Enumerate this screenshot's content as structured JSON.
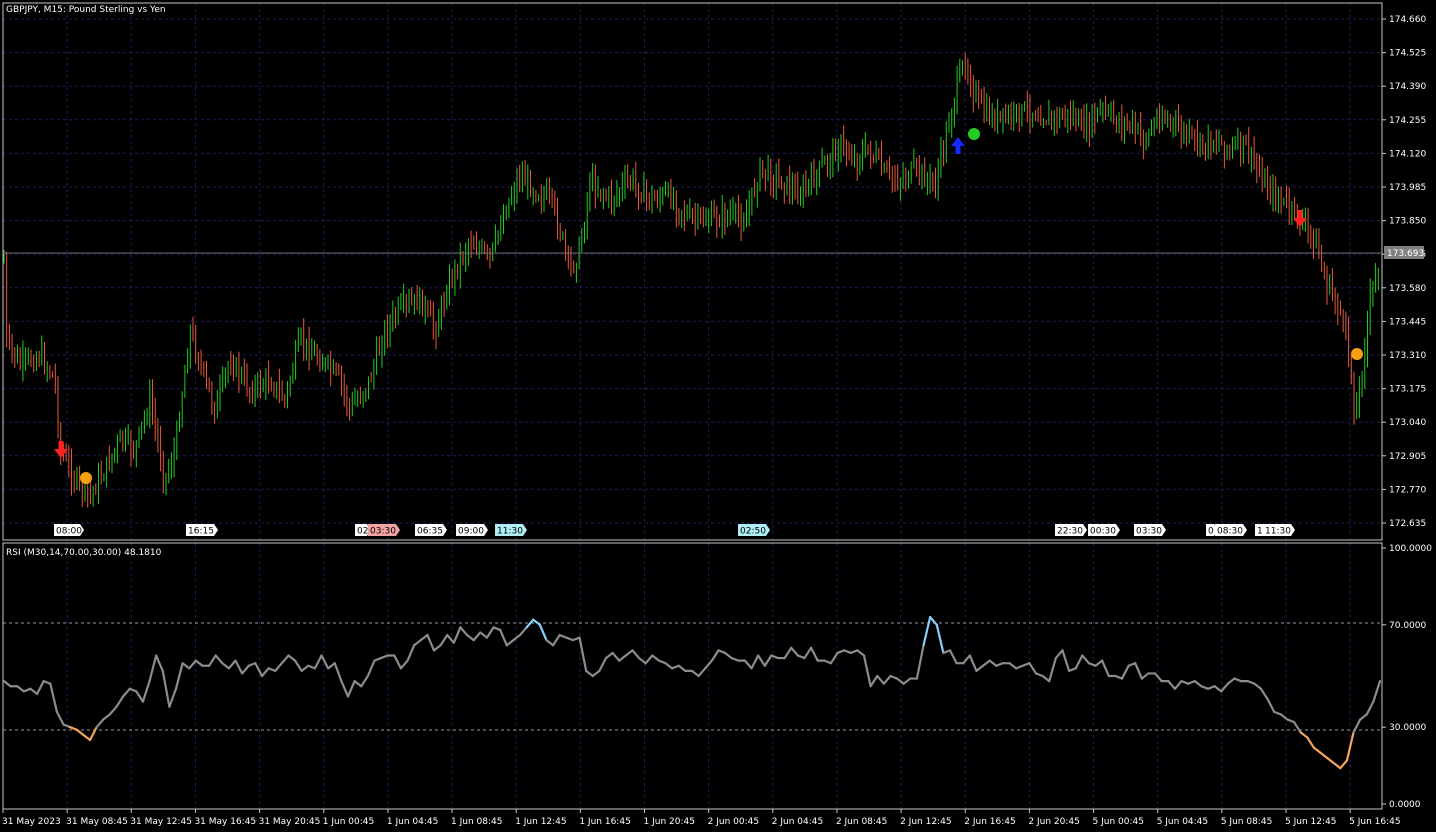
{
  "price_panel": {
    "title": "GBPJPY, M15:  Pound Sterling vs Yen",
    "price_axis_labels": [
      "174.660",
      "174.525",
      "174.390",
      "174.255",
      "174.120",
      "173.985",
      "173.850",
      "173.715",
      "173.580",
      "173.445",
      "173.310",
      "173.175",
      "173.040",
      "172.905",
      "172.770",
      "172.635"
    ],
    "current_price": "173.693",
    "session_tags": [
      {
        "text": "08:00",
        "color": "#ffffff"
      },
      {
        "text": "16:15",
        "color": "#ffffff"
      },
      {
        "text": "02",
        "color": "#ffffff"
      },
      {
        "text": "03:30",
        "color": "#f4a3a3"
      },
      {
        "text": "06:35",
        "color": "#ffffff"
      },
      {
        "text": "09:00",
        "color": "#ffffff"
      },
      {
        "text": "11:30",
        "color": "#aeeef4"
      },
      {
        "text": "02:50",
        "color": "#aeeef4"
      },
      {
        "text": "22:30",
        "color": "#ffffff"
      },
      {
        "text": "00:30",
        "color": "#ffffff"
      },
      {
        "text": "03:30",
        "color": "#ffffff"
      },
      {
        "text": "0",
        "color": "#ffffff"
      },
      {
        "text": "08:30",
        "color": "#ffffff"
      },
      {
        "text": "1",
        "color": "#ffffff"
      },
      {
        "text": "11:30",
        "color": "#ffffff"
      }
    ],
    "signals": [
      {
        "type": "sell-arrow",
        "color": "#ff2020"
      },
      {
        "type": "exit-dot",
        "color": "#f5a010"
      },
      {
        "type": "buy-arrow",
        "color": "#1428ff"
      },
      {
        "type": "exit-dot",
        "color": "#22cc22"
      },
      {
        "type": "sell-arrow",
        "color": "#ff2020"
      },
      {
        "type": "exit-dot",
        "color": "#f5a010"
      }
    ],
    "candle_colors": {
      "bull": "#22cc22",
      "bear": "#e85a3a"
    }
  },
  "rsi_panel": {
    "title": "RSI (M30,14,70.00,30.00) 48.1810",
    "axis_labels": [
      "100.0000",
      "70.0000",
      "30.0000",
      "0.0000"
    ],
    "level_high": 70,
    "level_low": 30,
    "line_colors": {
      "normal": "#8c8c8c",
      "overbought": "#87cefa",
      "oversold": "#f4a460"
    },
    "values": [
      48,
      46,
      46,
      44,
      45,
      43,
      48,
      47,
      36,
      31,
      30,
      29,
      27,
      25,
      30,
      33,
      35,
      38,
      42,
      45,
      44,
      40,
      48,
      58,
      52,
      38,
      45,
      55,
      53,
      56,
      54,
      54,
      58,
      55,
      53,
      56,
      51,
      54,
      55,
      50,
      53,
      52,
      55,
      58,
      56,
      52,
      54,
      53,
      58,
      53,
      55,
      48,
      42,
      48,
      46,
      50,
      56,
      57,
      58,
      58,
      53,
      56,
      62,
      64,
      66,
      60,
      62,
      66,
      63,
      69,
      66,
      64,
      67,
      65,
      69,
      68,
      62,
      64,
      66,
      69,
      72,
      70,
      64,
      62,
      66,
      65,
      64,
      65,
      52,
      50,
      52,
      57,
      59,
      56,
      58,
      60,
      57,
      55,
      58,
      56,
      55,
      53,
      54,
      52,
      52,
      50,
      53,
      56,
      60,
      59,
      57,
      56,
      56,
      53,
      58,
      54,
      58,
      57,
      57,
      61,
      58,
      57,
      61,
      56,
      56,
      55,
      59,
      60,
      59,
      60,
      58,
      46,
      50,
      47,
      50,
      49,
      47,
      49,
      49,
      62,
      73,
      70,
      59,
      60,
      55,
      55,
      58,
      52,
      54,
      56,
      54,
      55,
      55,
      53,
      54,
      55,
      51,
      50,
      48,
      57,
      60,
      52,
      53,
      58,
      55,
      54,
      56,
      50,
      50,
      49,
      54,
      55,
      49,
      51,
      51,
      48,
      48,
      45,
      48,
      47,
      48,
      46,
      45,
      46,
      44,
      47,
      49,
      48,
      48,
      47,
      45,
      41,
      36,
      35,
      33,
      32,
      28,
      26,
      22,
      20,
      18,
      16,
      14,
      17,
      28,
      33,
      35,
      40,
      48
    ]
  },
  "time_axis": {
    "labels": [
      "31 May 2023",
      "31 May 08:45",
      "31 May 12:45",
      "31 May 16:45",
      "31 May 20:45",
      "1 Jun 00:45",
      "1 Jun 04:45",
      "1 Jun 08:45",
      "1 Jun 12:45",
      "1 Jun 16:45",
      "1 Jun 20:45",
      "2 Jun 00:45",
      "2 Jun 04:45",
      "2 Jun 08:45",
      "2 Jun 12:45",
      "2 Jun 16:45",
      "2 Jun 20:45",
      "5 Jun 00:45",
      "5 Jun 04:45",
      "5 Jun 08:45",
      "5 Jun 12:45",
      "5 Jun 16:45"
    ]
  },
  "colors": {
    "grid": "#1c1c5c",
    "frame": "#c8c8c8",
    "current_price_line": "#707070"
  }
}
